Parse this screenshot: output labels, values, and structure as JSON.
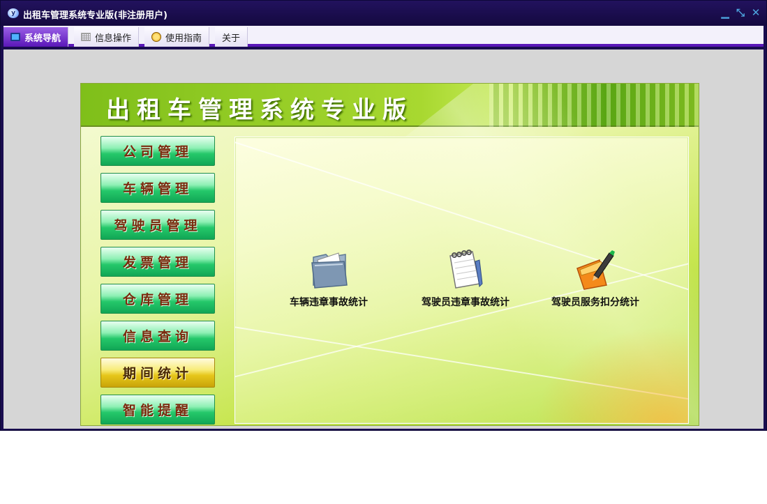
{
  "window": {
    "title": "出租车管理系统专业版(非注册用户)",
    "controls": {
      "minimize": "▁",
      "restore": "⤡",
      "close": "✕"
    }
  },
  "menu": {
    "tabs": [
      {
        "label": "系统导航",
        "icon": "monitor-icon"
      },
      {
        "label": "信息操作",
        "icon": "grid-icon"
      },
      {
        "label": "使用指南",
        "icon": "guide-icon"
      },
      {
        "label": "关于",
        "icon": ""
      }
    ]
  },
  "panel": {
    "title": "出租车管理系统专业版"
  },
  "sidebar": {
    "items": [
      {
        "label": "公司管理"
      },
      {
        "label": "车辆管理"
      },
      {
        "label": "驾驶员管理"
      },
      {
        "label": "发票管理"
      },
      {
        "label": "仓库管理"
      },
      {
        "label": "信息查询"
      },
      {
        "label": "期间统计",
        "selected": true
      },
      {
        "label": "智能提醒"
      }
    ]
  },
  "content": {
    "items": [
      {
        "label": "车辆违章事故统计",
        "icon": "folder-document-icon"
      },
      {
        "label": "驾驶员违章事故统计",
        "icon": "notepad-icon"
      },
      {
        "label": "驾驶员服务扣分统计",
        "icon": "orange-folder-pen-icon"
      }
    ]
  },
  "colors": {
    "titlebar": "#1a0d4f",
    "menu_accent": "#5a17b8",
    "sidebar_green": "#25c86a",
    "sidebar_selected": "#e6c61a"
  }
}
